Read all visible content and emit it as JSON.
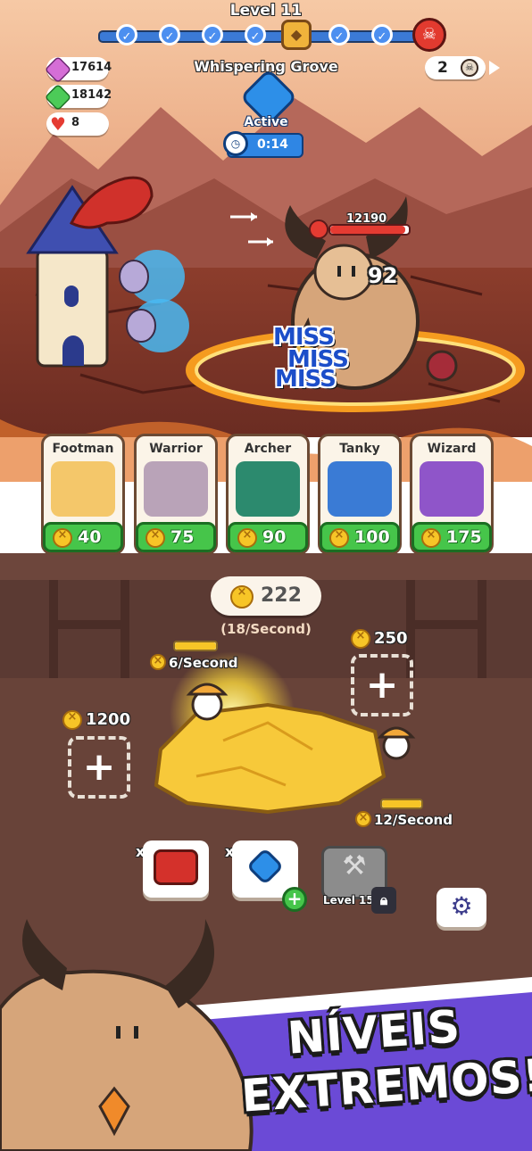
{
  "header": {
    "level_title": "Level 11",
    "stage_name": "Whispering Grove",
    "progress_nodes": [
      "check",
      "check",
      "check",
      "check",
      "chest",
      "check",
      "check",
      "boss"
    ],
    "skull_count": "2"
  },
  "resources": {
    "pink_gems": "17614",
    "green_gems": "18142",
    "hearts": "8"
  },
  "ability": {
    "status": "Active",
    "timer": "0:14"
  },
  "battle": {
    "boss_hp": "12190",
    "boss_hp_fraction": 0.95,
    "damage": "92",
    "miss_texts": [
      "MISS",
      "MISS",
      "MISS"
    ]
  },
  "units": [
    {
      "name": "Footman",
      "cost": "40",
      "color": "#f4c76a"
    },
    {
      "name": "Warrior",
      "cost": "75",
      "color": "#b9a3b8"
    },
    {
      "name": "Archer",
      "cost": "90",
      "color": "#2c8a6e"
    },
    {
      "name": "Tanky",
      "cost": "100",
      "color": "#3a7bd5"
    },
    {
      "name": "Wizard",
      "cost": "175",
      "color": "#8f55c9"
    }
  ],
  "mine": {
    "gold": "222",
    "rate": "(18/Second)",
    "miner_left_rate": "6/Second",
    "miner_right_rate": "12/Second",
    "slot_left_cost": "1200",
    "slot_right_cost": "250"
  },
  "powerups": {
    "turret_count": "x1",
    "gem_count": "x0",
    "locked_level": "Level 15"
  },
  "promo": {
    "line1": "NÍVEIS",
    "line2": "EXTREMOS!"
  },
  "colors": {
    "accent_green": "#46c54a",
    "accent_blue": "#2f86e4",
    "gold": "#f7c527",
    "promo_purple": "#6b4ad6"
  }
}
